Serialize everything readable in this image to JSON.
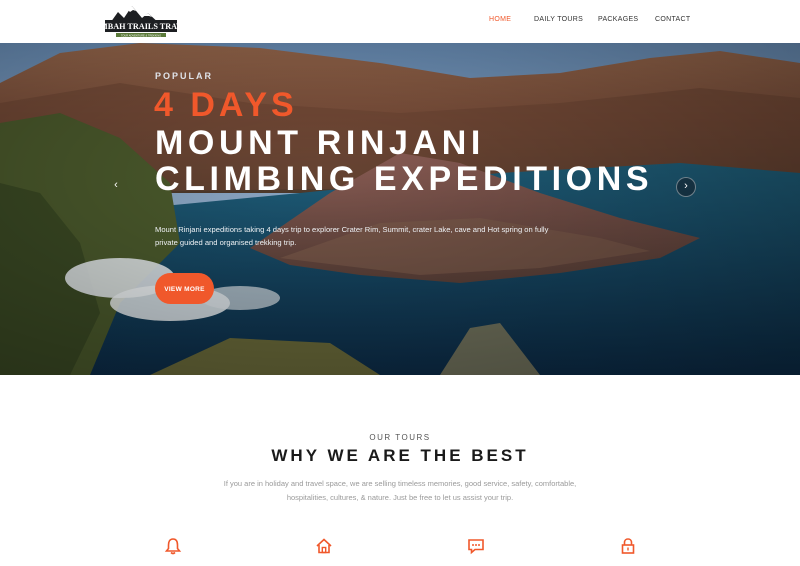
{
  "brand": {
    "name": "LEMBAH TRAILS TRAVEL",
    "tagline": "TOUR ADVENTURE & TREKKING",
    "colors": {
      "accent": "#f0582b",
      "logo_dark": "#1d1f22",
      "logo_green": "#5b7a3a"
    }
  },
  "nav": {
    "items": [
      {
        "label": "HOME",
        "active": true
      },
      {
        "label": "DAILY TOURS",
        "active": false
      },
      {
        "label": "PACKAGES",
        "active": false
      },
      {
        "label": "CONTACT",
        "active": false
      }
    ]
  },
  "hero": {
    "eyebrow": "POPULAR",
    "days": "4 DAYS",
    "title_line1": "MOUNT RINJANI",
    "title_line2": "CLIMBING EXPEDITIONS",
    "description": "Mount Rinjani expeditions taking 4 days trip to explorer Crater Rim, Summit, crater Lake, cave and Hot spring on fully private guided and organised trekking trip.",
    "cta_label": "VIEW MORE",
    "prev_icon": "‹",
    "next_icon": "›"
  },
  "tours_section": {
    "subtitle": "OUR TOURS",
    "title": "WHY WE ARE THE BEST",
    "text": "If you are in holiday and travel space, we are selling timeless memories, good service, safety, comfortable, hospitalities, cultures, & nature. Just be free to let us assist your trip.",
    "features": [
      {
        "icon": "bell-icon"
      },
      {
        "icon": "home-icon"
      },
      {
        "icon": "chat-icon"
      },
      {
        "icon": "lock-icon"
      }
    ]
  }
}
